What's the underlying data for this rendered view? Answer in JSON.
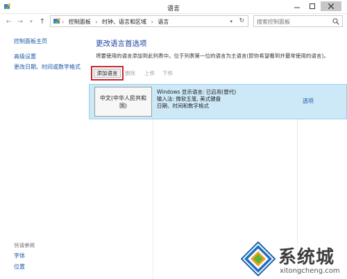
{
  "window": {
    "title": "语言"
  },
  "address": {
    "crumbs": [
      "控制面板",
      "时钟、语言和区域",
      "语言"
    ],
    "search_placeholder": "搜索控制面板"
  },
  "sidebar": {
    "top_links": [
      "控制面板主页",
      "高级设置",
      "更改日期、时间或数字格式"
    ],
    "see_also_heading": "另请参阅",
    "bottom_links": [
      "字体",
      "位置"
    ]
  },
  "main": {
    "title": "更改语言首选项",
    "description": "将要使用的语言添加到此列表中。位于列表第一位的语言为主语言(即你希望看到并最常使用的语言)。",
    "toolbar": {
      "add": "添加语言",
      "remove": "删除",
      "up": "上移",
      "down": "下移"
    },
    "language": {
      "name": "中文(中华人民共和国)",
      "info_lines": [
        "Windows 显示语言: 已启用(替代)",
        "输入法: 微软五笔, 美式键盘",
        "日期、时间和数字格式"
      ],
      "options_link": "选项"
    }
  },
  "watermark": {
    "text": "系统城",
    "url": "xitongcheng.com"
  },
  "colors": {
    "link": "#1a56a8",
    "title": "#1a3e9e",
    "selection_bg": "#cde8f7",
    "highlight_box": "#c4242c"
  }
}
